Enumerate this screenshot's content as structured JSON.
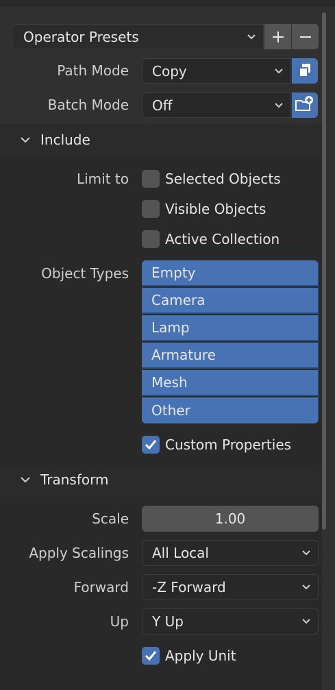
{
  "presets": {
    "label": "Operator Presets",
    "add": "+",
    "remove": "−"
  },
  "path_mode": {
    "label": "Path Mode",
    "value": "Copy"
  },
  "batch_mode": {
    "label": "Batch Mode",
    "value": "Off"
  },
  "include": {
    "title": "Include",
    "limit_to_label": "Limit to",
    "limit_options": [
      {
        "label": "Selected Objects",
        "checked": false
      },
      {
        "label": "Visible Objects",
        "checked": false
      },
      {
        "label": "Active Collection",
        "checked": false
      }
    ],
    "object_types_label": "Object Types",
    "object_types": [
      "Empty",
      "Camera",
      "Lamp",
      "Armature",
      "Mesh",
      "Other"
    ],
    "custom_properties": {
      "label": "Custom Properties",
      "checked": true
    }
  },
  "transform": {
    "title": "Transform",
    "scale": {
      "label": "Scale",
      "value": "1.00"
    },
    "apply_scalings": {
      "label": "Apply Scalings",
      "value": "All Local"
    },
    "forward": {
      "label": "Forward",
      "value": "-Z Forward"
    },
    "up": {
      "label": "Up",
      "value": "Y Up"
    },
    "apply_unit": {
      "label": "Apply Unit",
      "checked": true
    }
  },
  "colors": {
    "accent": "#4772b3",
    "background": "#303030",
    "field": "#282828"
  }
}
